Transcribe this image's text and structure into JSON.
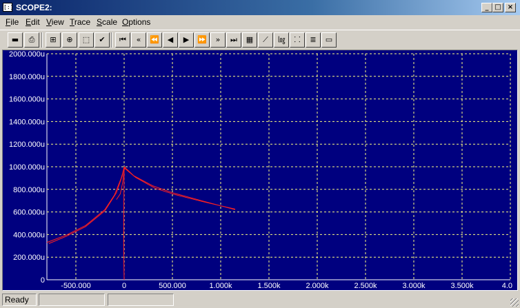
{
  "window": {
    "title": "SCOPE2:",
    "icon_label": "[:]",
    "caption_minimize": "_",
    "caption_maximize": "□",
    "caption_close": "×"
  },
  "menu": {
    "items": [
      "File",
      "Edit",
      "View",
      "Trace",
      "Scale",
      "Options"
    ],
    "mnemonics": [
      "F",
      "E",
      "V",
      "T",
      "S",
      "O"
    ]
  },
  "toolbar": {
    "buttons": [
      {
        "name": "save-button",
        "icon": "floppy-disk-icon",
        "glyph": "▬"
      },
      {
        "name": "print-button",
        "icon": "printer-icon",
        "glyph": "⎙"
      },
      {
        "name": "tree-button",
        "icon": "hierarchy-icon",
        "glyph": "⊞"
      },
      {
        "name": "target-button",
        "icon": "target-icon",
        "glyph": "⊕"
      },
      {
        "name": "select-area-button",
        "icon": "dotted-rect-icon",
        "glyph": "⬚"
      },
      {
        "name": "check-button",
        "icon": "check-icon",
        "glyph": "✔"
      },
      {
        "name": "first-button",
        "icon": "skip-first-icon",
        "glyph": "⏮"
      },
      {
        "name": "fast-back-button",
        "icon": "fast-back-icon",
        "glyph": "«"
      },
      {
        "name": "rewind-button",
        "icon": "rewind-icon",
        "glyph": "⏪"
      },
      {
        "name": "step-back-button",
        "icon": "step-back-icon",
        "glyph": "◀"
      },
      {
        "name": "play-button",
        "icon": "play-icon",
        "glyph": "▶"
      },
      {
        "name": "forward-button",
        "icon": "forward-icon",
        "glyph": "⏩"
      },
      {
        "name": "fast-forward-button",
        "icon": "fast-forward-icon",
        "glyph": "»"
      },
      {
        "name": "last-button",
        "icon": "skip-last-icon",
        "glyph": "⏭"
      },
      {
        "name": "grid-button",
        "icon": "grid-icon",
        "glyph": "▦"
      },
      {
        "name": "chart-linear-button",
        "icon": "chart-icon",
        "glyph": "⟋"
      },
      {
        "name": "chart-log-button",
        "icon": "chart-log-icon",
        "glyph": "㏒"
      },
      {
        "name": "chart-scatter-button",
        "icon": "chart-scatter-icon",
        "glyph": "⸬"
      },
      {
        "name": "list-button",
        "icon": "list-icon",
        "glyph": "≣"
      },
      {
        "name": "window-button",
        "icon": "window-icon",
        "glyph": "▭"
      }
    ]
  },
  "chart_data": {
    "type": "line",
    "title": "",
    "xlabel": "",
    "ylabel": "",
    "xlim": [
      -800000,
      4000000
    ],
    "ylim": [
      0,
      2000
    ],
    "x_ticks": [
      {
        "value": -500000,
        "label": "-500.000"
      },
      {
        "value": 0,
        "label": "0"
      },
      {
        "value": 500000,
        "label": "500.000"
      },
      {
        "value": 1000000,
        "label": "1.000k"
      },
      {
        "value": 1500000,
        "label": "1.500k"
      },
      {
        "value": 2000000,
        "label": "2.000k"
      },
      {
        "value": 2500000,
        "label": "2.500k"
      },
      {
        "value": 3000000,
        "label": "3.000k"
      },
      {
        "value": 3500000,
        "label": "3.500k"
      },
      {
        "value": 4000000,
        "label": "4.0"
      }
    ],
    "y_ticks": [
      {
        "value": 0,
        "label": "0"
      },
      {
        "value": 200,
        "label": "200.000u"
      },
      {
        "value": 400,
        "label": "400.000u"
      },
      {
        "value": 600,
        "label": "600.000u"
      },
      {
        "value": 800,
        "label": "800.000u"
      },
      {
        "value": 1000,
        "label": "1000.000u"
      },
      {
        "value": 1200,
        "label": "1200.000u"
      },
      {
        "value": 1400,
        "label": "1400.000u"
      },
      {
        "value": 1600,
        "label": "1600.000u"
      },
      {
        "value": 1800,
        "label": "1800.000u"
      },
      {
        "value": 2000,
        "label": "2000.000u"
      }
    ],
    "grid": true,
    "colors": {
      "background": "#00007f",
      "grid": "#ffff80",
      "trace": "#ff2020",
      "tick_text": "#ffffff"
    },
    "series": [
      {
        "x": [
          -800000,
          -600000,
          -400000,
          -200000,
          -100000,
          -30000,
          0
        ],
        "y": [
          330,
          395,
          480,
          620,
          750,
          900,
          990
        ]
      },
      {
        "x": [
          -780000,
          -600000,
          -400000,
          -200000,
          -80000,
          -20000,
          0
        ],
        "y": [
          320,
          385,
          470,
          610,
          770,
          920,
          1000
        ]
      },
      {
        "x": [
          0,
          100000,
          300000,
          500000,
          800000,
          1150000
        ],
        "y": [
          1000,
          920,
          830,
          770,
          700,
          620
        ]
      },
      {
        "x": [
          0,
          120000,
          320000,
          520000,
          820000,
          1150000
        ],
        "y": [
          990,
          905,
          810,
          755,
          690,
          625
        ]
      },
      {
        "x": [
          -80000,
          -40000,
          -15000,
          0,
          10000
        ],
        "y": [
          710,
          760,
          860,
          970,
          1000
        ]
      },
      {
        "x": [
          0,
          -3000,
          -5000,
          -3000,
          0
        ],
        "y": [
          1000,
          700,
          400,
          150,
          0
        ]
      }
    ]
  },
  "status": {
    "text": "Ready",
    "pane2": "",
    "pane3": ""
  }
}
